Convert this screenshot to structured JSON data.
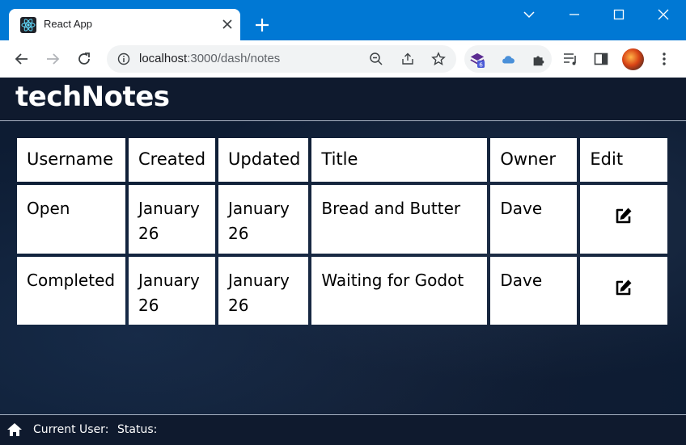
{
  "browser": {
    "tab_title": "React App",
    "url_host": "localhost",
    "url_rest": ":3000/dash/notes",
    "extension_badge": "6"
  },
  "app": {
    "title": "techNotes",
    "table": {
      "headers": [
        "Username",
        "Created",
        "Updated",
        "Title",
        "Owner",
        "Edit"
      ],
      "rows": [
        {
          "status": "Open",
          "created": "January 26",
          "updated": "January 26",
          "title": "Bread and Butter",
          "owner": "Dave"
        },
        {
          "status": "Completed",
          "created": "January 26",
          "updated": "January 26",
          "title": "Waiting for Godot",
          "owner": "Dave"
        }
      ]
    },
    "footer": {
      "current_user_label": "Current User:",
      "status_label": "Status:"
    }
  },
  "colors": {
    "titlebar": "#0078d4",
    "app_background": "#0d1c33",
    "status_open": "#a32626",
    "status_completed": "#3fbf3f"
  }
}
